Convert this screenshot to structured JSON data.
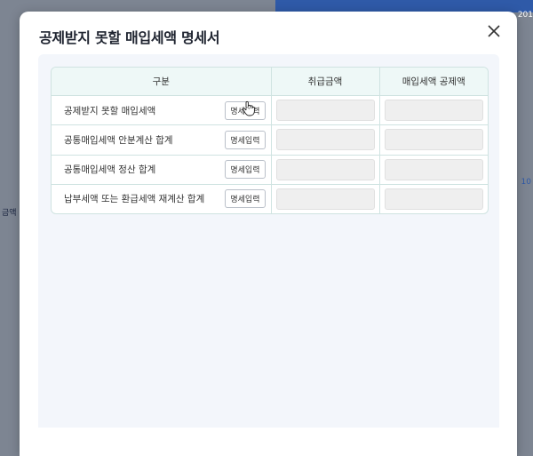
{
  "background": {
    "left_text": "금액",
    "right_text": "10",
    "top_right_text": "201"
  },
  "modal": {
    "title": "공제받지 못할  매입세액 명세서",
    "close_icon": "close-icon"
  },
  "table": {
    "headers": [
      "구분",
      "취급금액",
      "매입세액 공제액"
    ],
    "rows": [
      {
        "label": "공제받지 못할 매입세액",
        "button": "명세입력",
        "amount": "",
        "deduction": ""
      },
      {
        "label": "공통매입세액 안분계산 합계",
        "button": "명세입력",
        "amount": "",
        "deduction": ""
      },
      {
        "label": "공통매입세액 정산 합계",
        "button": "명세입력",
        "amount": "",
        "deduction": ""
      },
      {
        "label": "납부세액 또는 환급세액 재계산 합계",
        "button": "명세입력",
        "amount": "",
        "deduction": ""
      }
    ]
  }
}
